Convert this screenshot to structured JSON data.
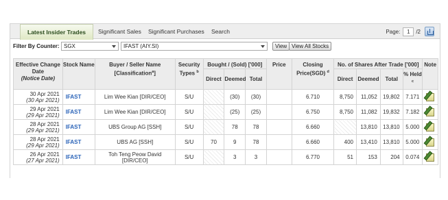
{
  "tabs": [
    {
      "label": "Latest Insider Trades",
      "active": true
    },
    {
      "label": "Significant Sales",
      "active": false
    },
    {
      "label": "Significant Purchases",
      "active": false
    },
    {
      "label": "Search",
      "active": false
    }
  ],
  "pager": {
    "prefix": "Page:",
    "current": "1",
    "total": "/2"
  },
  "filter": {
    "label": "Filter By Counter:",
    "exchange": "SGX",
    "stock": "IFAST (AIY.SI)",
    "view_label": "View",
    "view_all_label": "View All Stocks"
  },
  "headers": {
    "date": "Effective Change Date",
    "date_sub": "(Notice Date)",
    "stock": "Stock Name",
    "buyer": "Buyer / Seller Name",
    "buyer_class": "[Classification",
    "buyer_class_sup": "a",
    "buyer_class_close": "]",
    "security": "Security Types",
    "security_sup": "b",
    "bought": "Bought / (Sold) ['000]",
    "price": "Price",
    "closing": "Closing Price(SGD)",
    "closing_sup": "d",
    "shares_after": "No. of Shares After Trade ['000]",
    "note": "Note",
    "direct": "Direct",
    "deemed": "Deemed",
    "total": "Total",
    "pct_held": "% Held",
    "pct_held_sup": "c"
  },
  "rows": [
    {
      "date": "30 Apr 2021",
      "notice": "(30 Apr 2021)",
      "stock": "IFAST",
      "name": "Lim Wee Kian [DIR/CEO]",
      "security": "S/U",
      "b_direct": "",
      "b_deemed": "(30)",
      "b_total": "(30)",
      "price": "",
      "closing": "6.710",
      "s_direct": "8,750",
      "s_deemed": "11,052",
      "s_total": "19,802",
      "pct": "7.171"
    },
    {
      "date": "29 Apr 2021",
      "notice": "(29 Apr 2021)",
      "stock": "IFAST",
      "name": "Lim Wee Kian [DIR/CEO]",
      "security": "S/U",
      "b_direct": "",
      "b_deemed": "(25)",
      "b_total": "(25)",
      "price": "",
      "closing": "6.750",
      "s_direct": "8,750",
      "s_deemed": "11,082",
      "s_total": "19,832",
      "pct": "7.182"
    },
    {
      "date": "28 Apr 2021",
      "notice": "(29 Apr 2021)",
      "stock": "IFAST",
      "name": "UBS Group AG [SSH]",
      "security": "S/U",
      "b_direct": "",
      "b_deemed": "78",
      "b_total": "78",
      "price": "",
      "closing": "6.660",
      "s_direct": "",
      "s_deemed": "13,810",
      "s_total": "13,810",
      "pct": "5.000"
    },
    {
      "date": "28 Apr 2021",
      "notice": "(29 Apr 2021)",
      "stock": "IFAST",
      "name": "UBS AG [SSH]",
      "security": "S/U",
      "b_direct": "70",
      "b_deemed": "9",
      "b_total": "78",
      "price": "",
      "closing": "6.660",
      "s_direct": "400",
      "s_deemed": "13,410",
      "s_total": "13,810",
      "pct": "5.000"
    },
    {
      "date": "26 Apr 2021",
      "notice": "(27 Apr 2021)",
      "stock": "IFAST",
      "name": "Toh Teng Peow David [DIR/CEO]",
      "security": "S/U",
      "b_direct": "",
      "b_deemed": "3",
      "b_total": "3",
      "price": "",
      "closing": "6.770",
      "s_direct": "51",
      "s_deemed": "153",
      "s_total": "204",
      "pct": "0.074"
    }
  ]
}
